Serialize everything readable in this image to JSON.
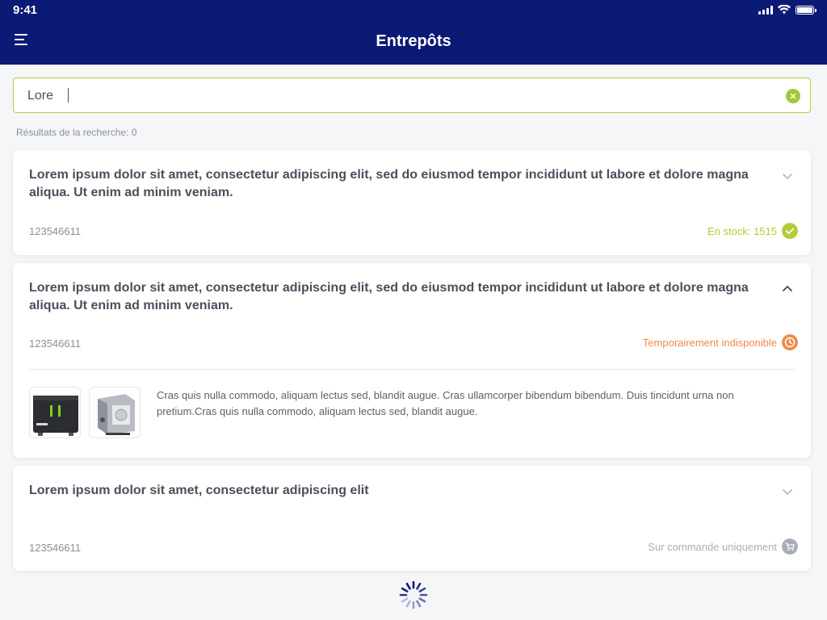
{
  "status_bar": {
    "time": "9:41"
  },
  "header": {
    "title": "Entrepôts"
  },
  "search": {
    "value": "Lore",
    "results_label": "Résultats de la recherche: 0"
  },
  "products": [
    {
      "title": "Lorem ipsum dolor sit amet, consectetur adipiscing elit, sed do eiusmod tempor incididunt ut labore et dolore magna aliqua. Ut enim ad minim veniam.",
      "reference": "123546611",
      "status": "En stock: 1515",
      "status_color": "#b5cc3a",
      "status_icon": "check-circle-icon",
      "expanded": false
    },
    {
      "title": "Lorem ipsum dolor sit amet, consectetur adipiscing elit, sed do eiusmod tempor incididunt ut labore et dolore magna aliqua. Ut enim ad minim veniam.",
      "reference": "123546611",
      "status": "Temporairement indisponible",
      "status_color": "#ee8a4a",
      "status_icon": "clock-icon",
      "expanded": true,
      "description": "Cras quis nulla commodo, aliquam lectus sed, blandit augue. Cras ullamcorper bibendum bibendum. Duis tincidunt urna non pretium.Cras quis nulla commodo, aliquam lectus sed, blandit augue."
    },
    {
      "title": "Lorem ipsum dolor sit amet, consectetur adipiscing elit",
      "reference": "123546611",
      "status": "Sur commande uniquement",
      "status_color": "#a9adb7",
      "status_icon": "cart-icon",
      "expanded": false
    }
  ],
  "colors": {
    "header_bg": "#0a1a75",
    "accent": "#b5cc3a",
    "spinner": "#0a1a75"
  }
}
